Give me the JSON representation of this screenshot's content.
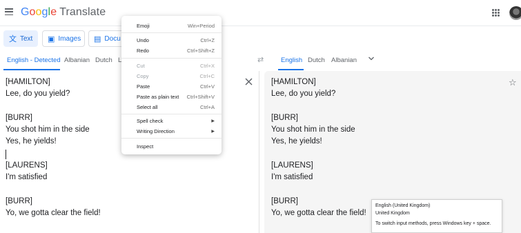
{
  "header": {
    "logo_google": "Google",
    "logo_translate": "Translate",
    "brand_colors": [
      "#4285f4",
      "#ea4335",
      "#fbbc05",
      "#4285f4",
      "#34a853",
      "#ea4335"
    ]
  },
  "modes": {
    "text": "Text",
    "images": "Images",
    "docs": "Docu"
  },
  "source_langs": {
    "detected": "English - Detected",
    "albanian": "Albanian",
    "dutch": "Dutch",
    "partial": "L"
  },
  "target_langs": {
    "english": "English",
    "dutch": "Dutch",
    "albanian": "Albanian"
  },
  "source": {
    "lines": [
      "[HAMILTON]",
      "Lee, do you yield?",
      "",
      "[BURR]",
      "You shot him in the side",
      "Yes, he yields!",
      "",
      "[LAURENS]",
      "I'm satisfied",
      "",
      "[BURR]",
      "Yo, we gotta clear the field!"
    ]
  },
  "target": {
    "lines": [
      "[HAMILTON]",
      "Lee, do you yield?",
      "",
      "[BURR]",
      "You shot him in the side",
      "Yes, he yields!",
      "",
      "[LAURENS]",
      "I'm satisfied",
      "",
      "[BURR]",
      "Yo, we gotta clear the field!"
    ]
  },
  "context_menu": {
    "emoji": {
      "label": "Emoji",
      "shortcut": "Win+Period"
    },
    "undo": {
      "label": "Undo",
      "shortcut": "Ctrl+Z"
    },
    "redo": {
      "label": "Redo",
      "shortcut": "Ctrl+Shift+Z"
    },
    "cut": {
      "label": "Cut",
      "shortcut": "Ctrl+X"
    },
    "copy": {
      "label": "Copy",
      "shortcut": "Ctrl+C"
    },
    "paste": {
      "label": "Paste",
      "shortcut": "Ctrl+V"
    },
    "paste_plain": {
      "label": "Paste as plain text",
      "shortcut": "Ctrl+Shift+V"
    },
    "select_all": {
      "label": "Select all",
      "shortcut": "Ctrl+A"
    },
    "spell_check": {
      "label": "Spell check"
    },
    "writing_direction": {
      "label": "Writing Direction"
    },
    "inspect": {
      "label": "Inspect"
    }
  },
  "tooltip": {
    "line1": "English (United Kingdom)",
    "line2": "United Kingdom",
    "hint": "To switch input methods, press Windows key + space."
  }
}
